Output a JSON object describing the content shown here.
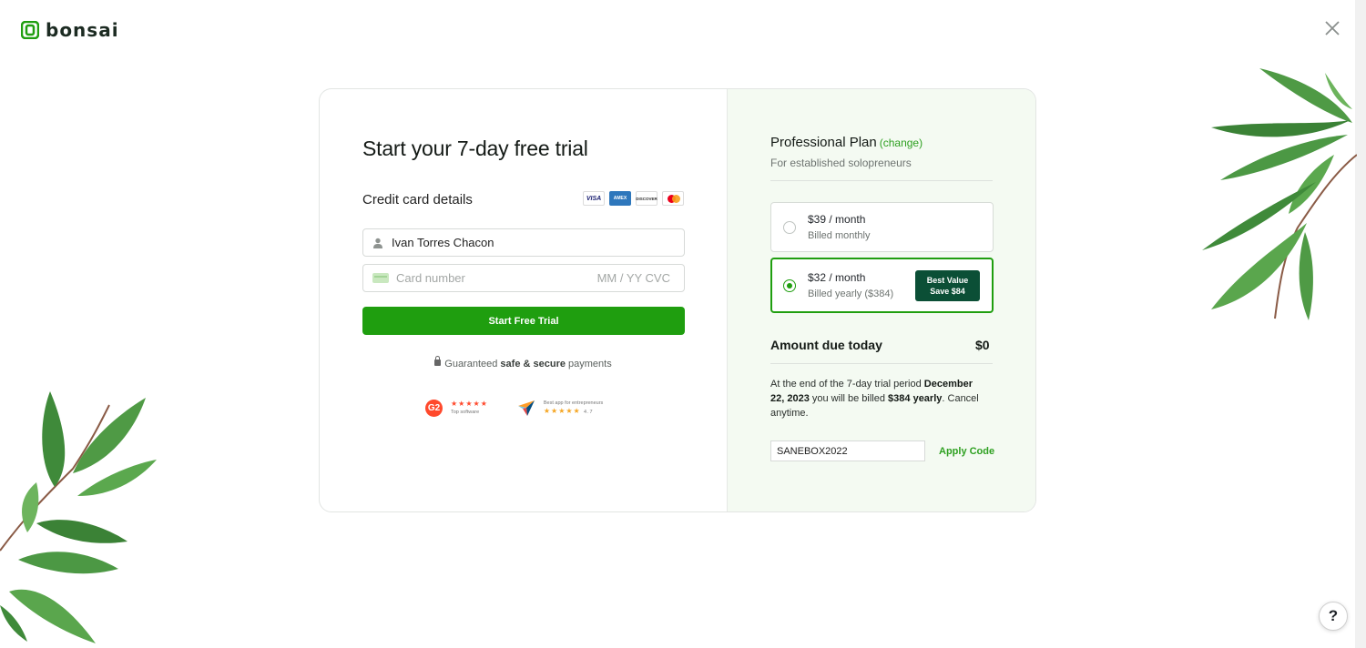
{
  "brand": {
    "name": "bonsai",
    "accent": "#1f9e0f",
    "dark": "#0b4f36"
  },
  "icons": {
    "close": "close-icon",
    "help": "?",
    "person": "person-icon",
    "card": "card-icon",
    "lock": "lock-icon"
  },
  "checkout": {
    "title": "Start your 7-day free trial",
    "cc_label": "Credit card details",
    "card_brands": [
      "VISA",
      "AMEX",
      "DISCOVER",
      "Mastercard"
    ],
    "name_value": "Ivan Torres Chacon",
    "card_placeholder": "Card number",
    "card_extra_placeholder": "MM / YY  CVC",
    "cta_label": "Start Free Trial",
    "secure_prefix": "Guaranteed ",
    "secure_bold": "safe & secure",
    "secure_suffix": " payments",
    "badges": [
      {
        "logo": "G2",
        "stars": "★★★★★",
        "caption": "Top software"
      },
      {
        "stars": "★★★★★",
        "caption_top": "Best app for entrepreneurs",
        "rating": "4.7"
      }
    ]
  },
  "plan": {
    "title": "Professional Plan",
    "change_label": "(change)",
    "subtitle": "For established solopreneurs",
    "options": [
      {
        "price": "$39 / month",
        "billing": "Billed monthly",
        "selected": false
      },
      {
        "price": "$32 / month",
        "billing": "Billed yearly ($384)",
        "selected": true,
        "badge_line1": "Best Value",
        "badge_line2": "Save $84"
      }
    ],
    "due_label": "Amount due today",
    "due_value": "$0",
    "note_prefix": "At the end of the 7-day trial period ",
    "note_date": "December 22, 2023",
    "note_mid": " you will be billed ",
    "note_amount": "$384 yearly",
    "note_suffix": ". Cancel anytime.",
    "promo_value": "SANEBOX2022",
    "apply_label": "Apply Code"
  }
}
